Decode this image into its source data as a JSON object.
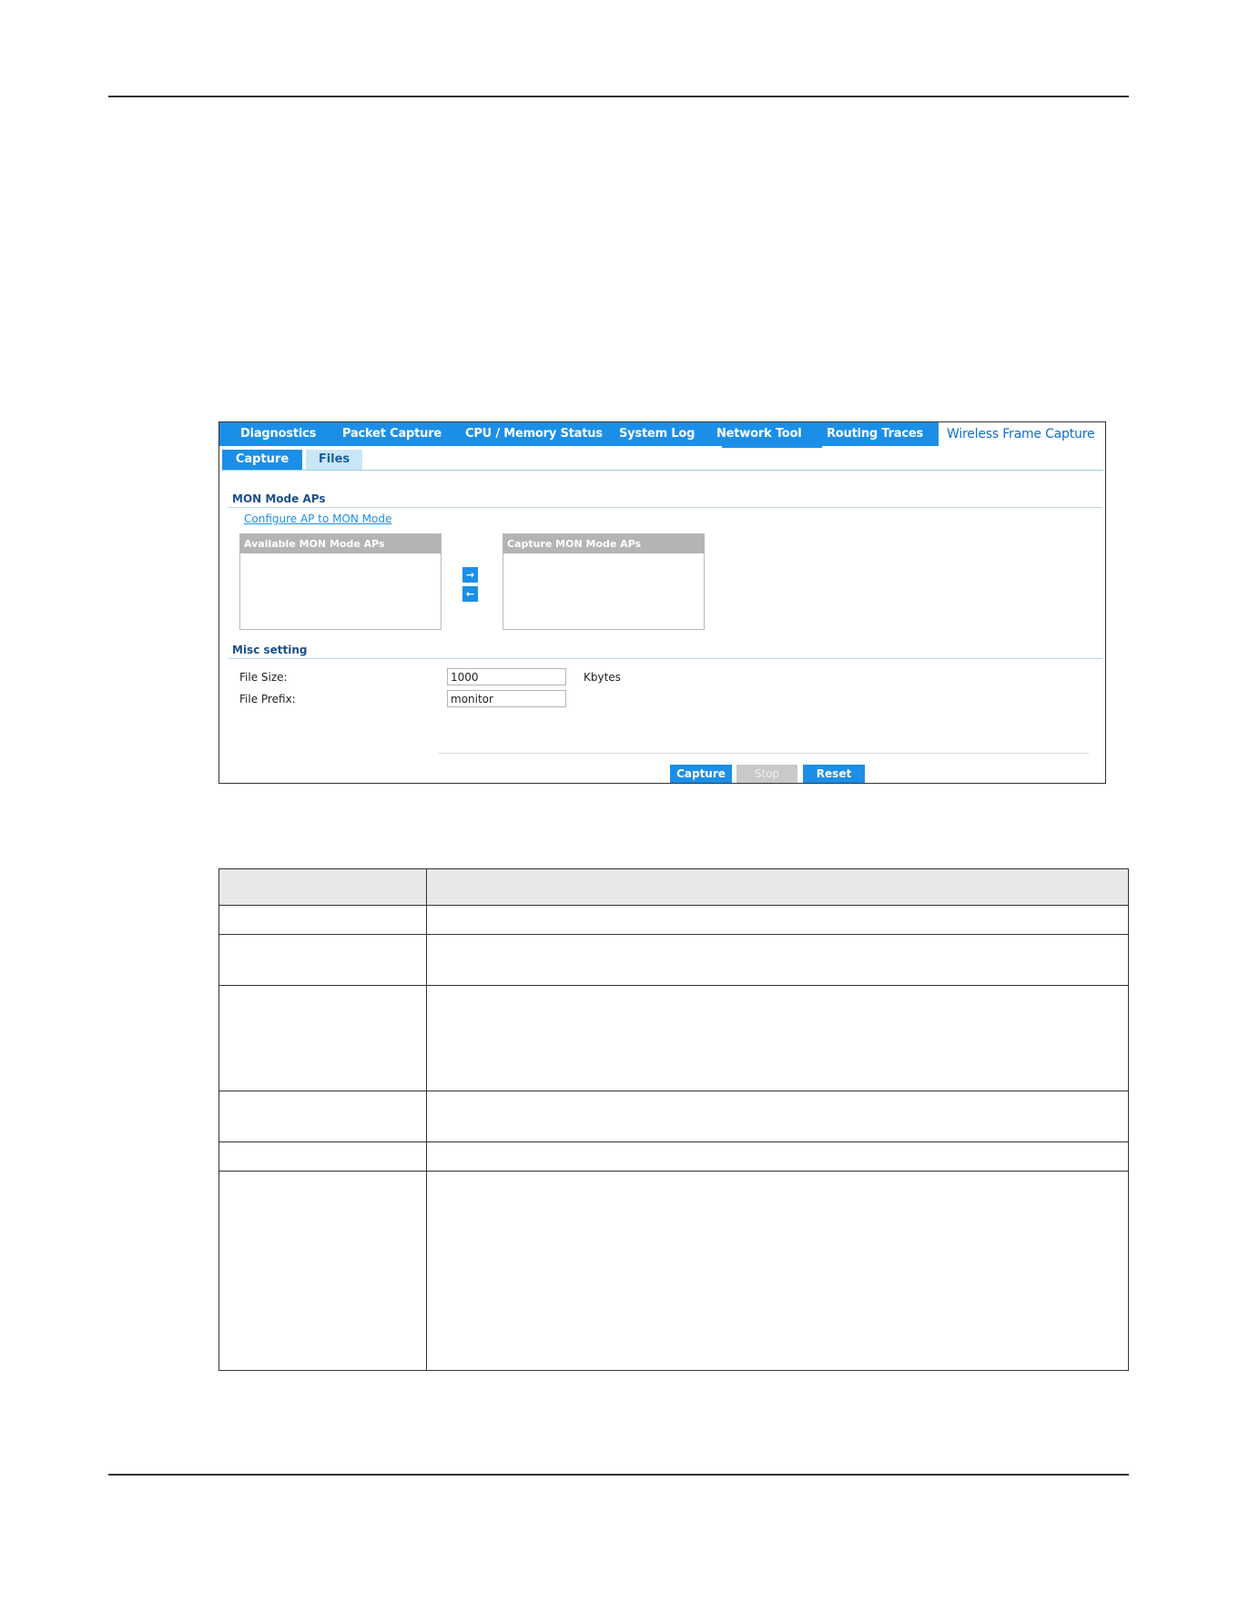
{
  "main_tabs": [
    {
      "label": "Diagnostics"
    },
    {
      "label": "Packet Capture"
    },
    {
      "label": "CPU / Memory Status"
    },
    {
      "label": "System Log"
    },
    {
      "label": "Network Tool"
    },
    {
      "label": "Routing Traces"
    },
    {
      "label": "Wireless Frame Capture"
    }
  ],
  "sub_tabs": [
    {
      "label": "Capture"
    },
    {
      "label": "Files"
    }
  ],
  "mon_section": {
    "title": "MON Mode APs",
    "link": "Configure AP to MON Mode",
    "available_header": "Available MON Mode APs",
    "capture_header": "Capture MON Mode APs",
    "add_glyph": "→",
    "remove_glyph": "←"
  },
  "misc_section": {
    "title": "Misc setting",
    "file_size_label": "File Size:",
    "file_size_value": "1000",
    "file_size_unit": "Kbytes",
    "file_prefix_label": "File Prefix:",
    "file_prefix_value": "monitor"
  },
  "buttons": {
    "capture": "Capture",
    "stop": "Stop",
    "reset": "Reset"
  },
  "colors": {
    "accent": "#1b8fe8",
    "disabled": "#c9c9c9"
  }
}
